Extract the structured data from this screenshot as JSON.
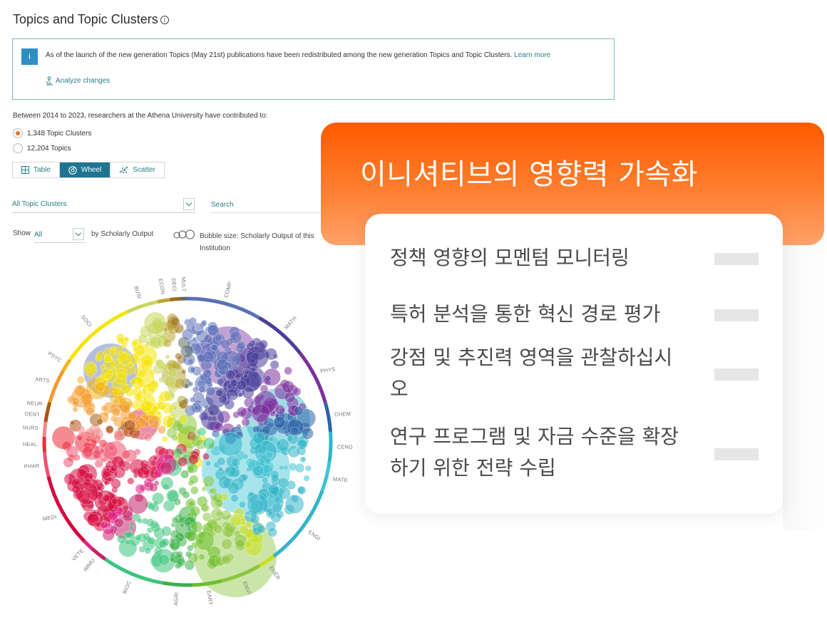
{
  "header": {
    "title": "Topics and Topic Clusters",
    "info_icon": "info-icon"
  },
  "notice": {
    "badge": "i",
    "text": "As of the launch of the new generation Topics (May 21st) publications have been redistributed among the new generation Topics and Topic Clusters.",
    "learn_more": "Learn more",
    "analyze_label": "Analyze changes",
    "analyze_icon": "microscope-icon"
  },
  "summary": {
    "intro": "Between 2014 to 2023, researchers at the Athena University have contributed to:",
    "options": [
      {
        "label": "1,348 Topic Clusters",
        "selected": true
      },
      {
        "label": "12,204 Topics",
        "selected": false
      }
    ]
  },
  "view_tabs": [
    {
      "label": "Table",
      "icon": "grid-icon",
      "active": false
    },
    {
      "label": "Wheel",
      "icon": "wheel-icon",
      "active": true
    },
    {
      "label": "Scatter",
      "icon": "scatter-icon",
      "active": false
    }
  ],
  "filters": {
    "cluster_select": "All Topic Clusters",
    "search_placeholder": "Search",
    "show_label": "Show",
    "show_value": "All",
    "by_label": "by Scholarly Output",
    "bubble_size_label": "Bubble size: Scholarly Output of this Institution"
  },
  "wheel": {
    "segments": [
      {
        "label": "COMP",
        "color": "#5b6fb8"
      },
      {
        "label": "MATH",
        "color": "#4b3f9a"
      },
      {
        "label": "PHYS",
        "color": "#7b2f9e"
      },
      {
        "label": "CHEM",
        "color": "#2c63a8"
      },
      {
        "label": "CENG",
        "color": "#2fb4c8"
      },
      {
        "label": "MATE",
        "color": "#3fc4d4"
      },
      {
        "label": "ENGI",
        "color": "#33b4c8"
      },
      {
        "label": "ENER",
        "color": "#c8e01a"
      },
      {
        "label": "ENVI",
        "color": "#8cc63f"
      },
      {
        "label": "EART",
        "color": "#6cbf2a"
      },
      {
        "label": "AGRI",
        "color": "#3bb04a"
      },
      {
        "label": "BIOC",
        "color": "#3cc47c"
      },
      {
        "label": "IMMU",
        "color": "#c4236a"
      },
      {
        "label": "VETE",
        "color": "#e0208a"
      },
      {
        "label": "MEDI",
        "color": "#d5093e"
      },
      {
        "label": "PHAR",
        "color": "#f0506e"
      },
      {
        "label": "HEAL",
        "color": "#ee2a38"
      },
      {
        "label": "NURS",
        "color": "#f08a8a"
      },
      {
        "label": "DENT",
        "color": "#b34d10"
      },
      {
        "label": "NEUR",
        "color": "#a35c10"
      },
      {
        "label": "ARTS",
        "color": "#f39a2a"
      },
      {
        "label": "PSYC",
        "color": "#f2b51a"
      },
      {
        "label": "SOCI",
        "color": "#f5e400"
      },
      {
        "label": "BUSI",
        "color": "#c7d65c"
      },
      {
        "label": "ECON",
        "color": "#b8a635"
      },
      {
        "label": "DECI",
        "color": "#9c6b1e"
      },
      {
        "label": "MULT",
        "color": "#5d6b60"
      }
    ]
  },
  "promo": {
    "title": "이니셔티브의 영향력 가속화",
    "items": [
      "정책 영향의 모멘텀 모니터링",
      "특허 분석을 통한 혁신 경로 평가",
      "강점 및 추진력 영역을 관찰하십시오",
      "연구 프로그램 및 자금 수준을 확장하기 위한 전략 수립"
    ]
  },
  "colors": {
    "accent": "#1f7591",
    "link": "#2a7f8c",
    "radio_selected": "#e9711c",
    "promo_orange": "#ff5a00"
  }
}
